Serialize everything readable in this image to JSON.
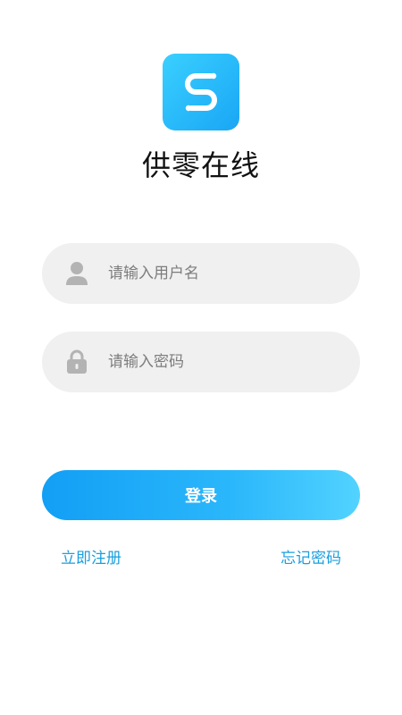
{
  "app": {
    "name": "供零在线",
    "logo_icon": "s-swap-logo-icon",
    "accent_color": "#19a6f5"
  },
  "form": {
    "username_placeholder": "请输入用户名",
    "password_placeholder": "请输入密码",
    "username_icon": "user-icon",
    "password_icon": "lock-icon",
    "login_label": "登录"
  },
  "links": {
    "register": "立即注册",
    "forgot_password": "忘记密码"
  }
}
